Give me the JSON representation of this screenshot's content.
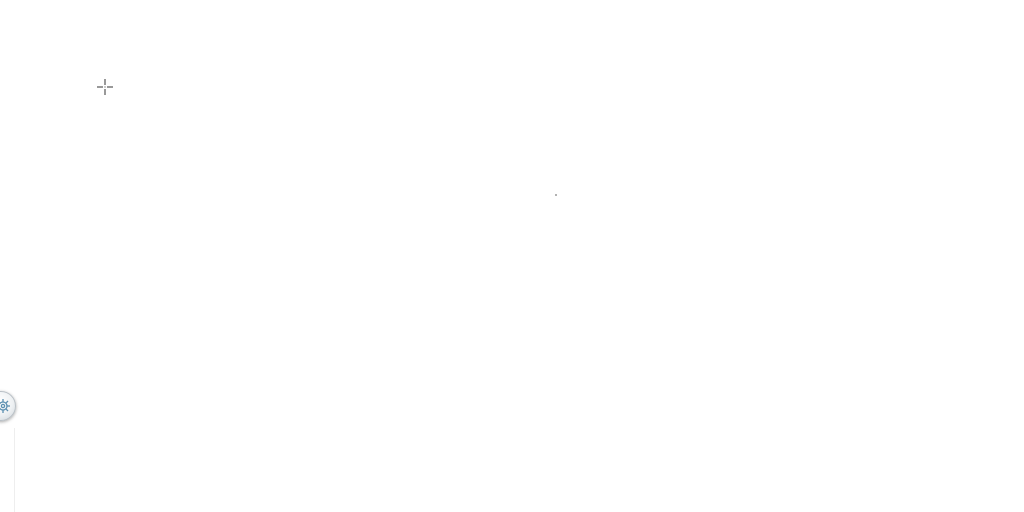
{
  "canvas": {
    "background": "#ffffff"
  },
  "cursor": {
    "icon": "crosshair-icon"
  },
  "floating_button": {
    "icon": "gear-icon",
    "accent": "#5a8fb0"
  }
}
